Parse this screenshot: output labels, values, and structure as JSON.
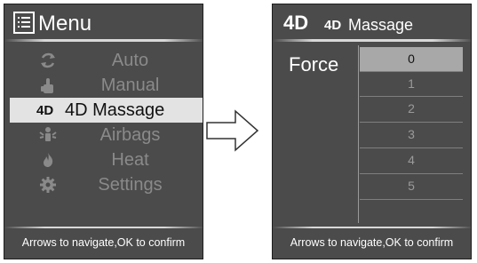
{
  "menu_panel": {
    "title": "Menu",
    "items": [
      {
        "label": "Auto",
        "icon": "cycle-icon",
        "selected": false
      },
      {
        "label": "Manual",
        "icon": "hand-icon",
        "selected": false
      },
      {
        "label": "4D Massage",
        "icon": "4d-icon",
        "badge": "4D",
        "selected": true
      },
      {
        "label": "Airbags",
        "icon": "airbag-icon",
        "selected": false
      },
      {
        "label": "Heat",
        "icon": "flame-icon",
        "selected": false
      },
      {
        "label": "Settings",
        "icon": "gear-icon",
        "selected": false
      }
    ],
    "footer": "Arrows to navigate,OK to confirm"
  },
  "massage_panel": {
    "badge": "4D",
    "title_badge": "4D",
    "title": "Massage",
    "force_label": "Force",
    "force_options": [
      "0",
      "1",
      "2",
      "3",
      "4",
      "5"
    ],
    "selected_index": 0,
    "footer": "Arrows to navigate,OK to confirm"
  },
  "colors": {
    "panel_bg": "#4b4b4b",
    "selection_bg": "#e3e3e3",
    "dim_text": "#8a8a8a"
  }
}
